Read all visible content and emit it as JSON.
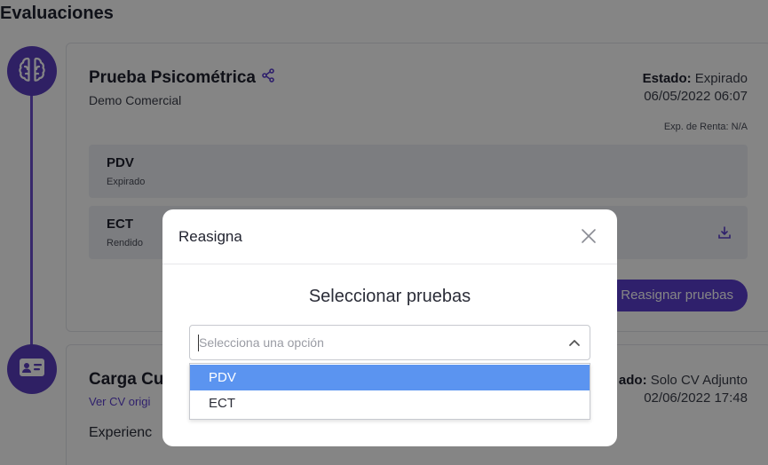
{
  "page": {
    "title": "Evaluaciones"
  },
  "colors": {
    "accent": "#5b3fd0",
    "highlight": "#5b94f0"
  },
  "cards": [
    {
      "title": "Prueba Psicométrica",
      "subtitle": "Demo Comercial",
      "status_label": "Estado:",
      "status_value": "Expirado",
      "date": "06/05/2022 06:07",
      "renta": "Exp. de Renta: N/A",
      "tests": [
        {
          "name": "PDV",
          "state": "Expirado"
        },
        {
          "name": "ECT",
          "state": "Rendido"
        }
      ],
      "reassign_label": "Reasignar pruebas"
    },
    {
      "title_visible": "Carga Cu",
      "link": "Ver CV origi",
      "status_label_visible": "ado:",
      "status_value": "Solo CV Adjunto",
      "date": "02/06/2022 17:48",
      "experience_visible": "Experienc"
    }
  ],
  "modal": {
    "title": "Reasigna",
    "heading": "Seleccionar pruebas",
    "select_placeholder": "Selecciona una opción",
    "options": [
      "PDV",
      "ECT"
    ],
    "highlighted_index": 0
  }
}
